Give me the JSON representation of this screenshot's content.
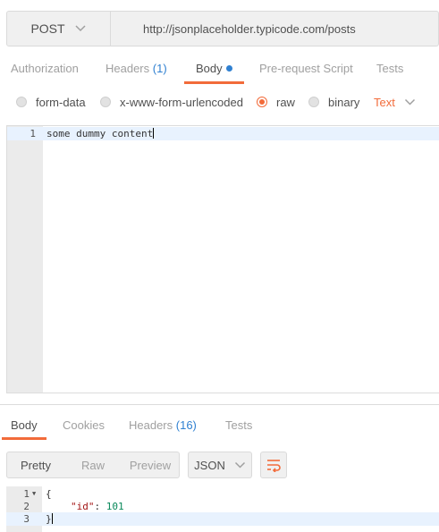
{
  "request": {
    "method": "POST",
    "url": "http://jsonplaceholder.typicode.com/posts"
  },
  "request_tabs": {
    "authorization": "Authorization",
    "headers": "Headers",
    "headers_count": "(1)",
    "body": "Body",
    "prerequest": "Pre-request Script",
    "tests": "Tests"
  },
  "body_types": {
    "form_data": "form-data",
    "urlencoded": "x-www-form-urlencoded",
    "raw": "raw",
    "binary": "binary",
    "selected": "raw",
    "text_type": "Text"
  },
  "request_body": {
    "line_number": "1",
    "content": "some dummy content"
  },
  "response_tabs": {
    "body": "Body",
    "cookies": "Cookies",
    "headers": "Headers",
    "headers_count": "(16)",
    "tests": "Tests"
  },
  "response_toolbar": {
    "pretty": "Pretty",
    "raw": "Raw",
    "preview": "Preview",
    "format": "JSON"
  },
  "response_body": {
    "lines": [
      {
        "num": "1",
        "text": "{"
      },
      {
        "num": "2",
        "key": "\"id\"",
        "sep": ": ",
        "value": "101"
      },
      {
        "num": "3",
        "text": "}"
      }
    ]
  },
  "colors": {
    "accent": "#f26b3a",
    "link": "#2f80d1",
    "highlight": "#e8f2fe"
  }
}
